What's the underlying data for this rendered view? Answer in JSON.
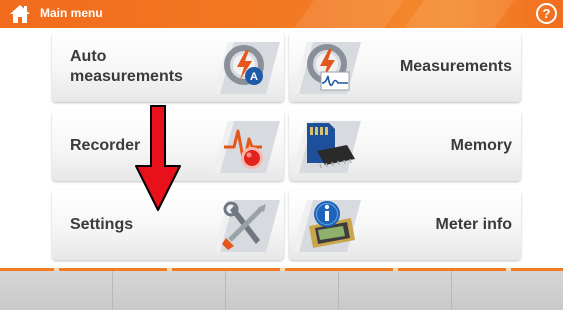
{
  "header": {
    "title": "Main menu",
    "help_label": "?",
    "home_icon": "home-icon",
    "accent_color": "#f37a24"
  },
  "menu": {
    "items": [
      {
        "label": "Auto measurements",
        "icon": "auto-measurement-icon"
      },
      {
        "label": "Measurements",
        "icon": "measurement-gauge-icon"
      },
      {
        "label": "Recorder",
        "icon": "recorder-icon"
      },
      {
        "label": "Memory",
        "icon": "memory-card-icon"
      },
      {
        "label": "Settings",
        "icon": "tools-icon"
      },
      {
        "label": "Meter info",
        "icon": "info-icon"
      }
    ]
  },
  "annotation": {
    "arrow_color": "#e8101a",
    "arrow_icon": "red-down-arrow"
  },
  "footer": {
    "buttons": [
      "",
      "",
      "",
      "",
      ""
    ],
    "background_color": "#d0d0d0"
  }
}
